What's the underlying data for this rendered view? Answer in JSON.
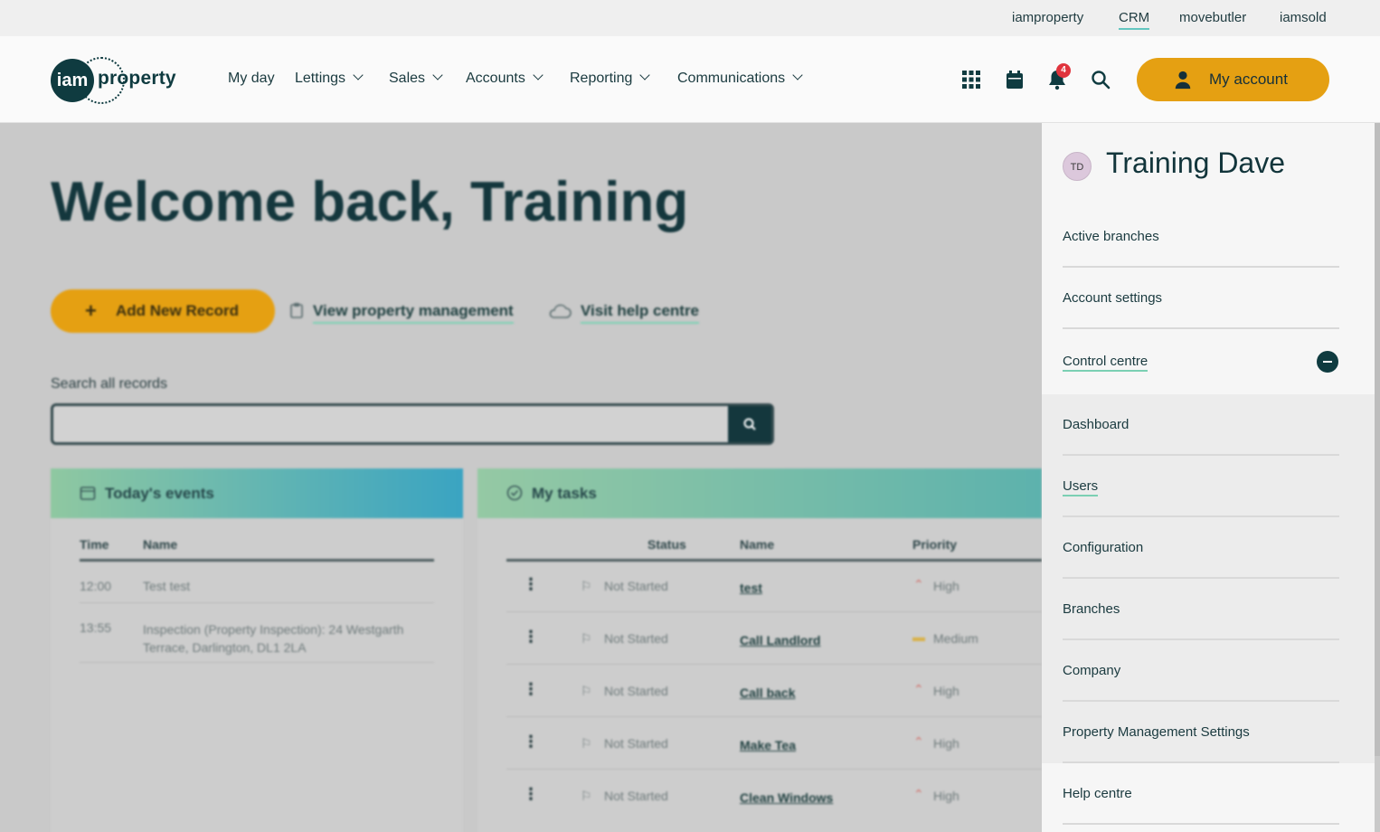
{
  "topbar": {
    "links": [
      "iamproperty",
      "CRM",
      "movebutler",
      "iamsold"
    ],
    "active": "CRM"
  },
  "logo": {
    "mark": "iam",
    "word": "property"
  },
  "nav": {
    "items": [
      "My day",
      "Lettings",
      "Sales",
      "Accounts",
      "Reporting",
      "Communications"
    ]
  },
  "header": {
    "icons": [
      "apps-grid-icon",
      "calendar-icon",
      "bell-icon",
      "search-icon"
    ],
    "notifications": "4",
    "account_label": "My account"
  },
  "main": {
    "welcome": "Welcome back, Training",
    "add_record": "Add New Record",
    "view_pm": "View property management",
    "help": "Visit help centre",
    "search_label": "Search all records"
  },
  "events": {
    "title": "Today's events",
    "headers": [
      "Time",
      "Name"
    ],
    "rows": [
      {
        "time": "12:00",
        "name": "Test test"
      },
      {
        "time": "13:55",
        "name": "Inspection (Property Inspection): 24 Westgarth Terrace, Darlington, DL1 2LA"
      }
    ]
  },
  "tasks": {
    "title": "My tasks",
    "headers": [
      "Status",
      "Name",
      "Priority"
    ],
    "rows": [
      {
        "status": "Not Started",
        "name": "test",
        "priority": "High"
      },
      {
        "status": "Not Started",
        "name": "Call Landlord",
        "priority": "Medium"
      },
      {
        "status": "Not Started",
        "name": "Call back",
        "priority": "High"
      },
      {
        "status": "Not Started",
        "name": "Make Tea",
        "priority": "High"
      },
      {
        "status": "Not Started",
        "name": "Clean Windows",
        "priority": "High"
      }
    ]
  },
  "panel": {
    "initials": "TD",
    "user": "Training Dave",
    "items": [
      "Active branches",
      "Account settings",
      "Control centre"
    ],
    "sub_items": [
      "Dashboard",
      "Users",
      "Configuration",
      "Branches",
      "Company",
      "Property Management Settings"
    ],
    "footer_item": "Help centre"
  },
  "colors": {
    "brand_dark": "#0f3b40",
    "accent": "#e5a012",
    "underline": "#7bd0b3",
    "badge": "#e0343d"
  }
}
